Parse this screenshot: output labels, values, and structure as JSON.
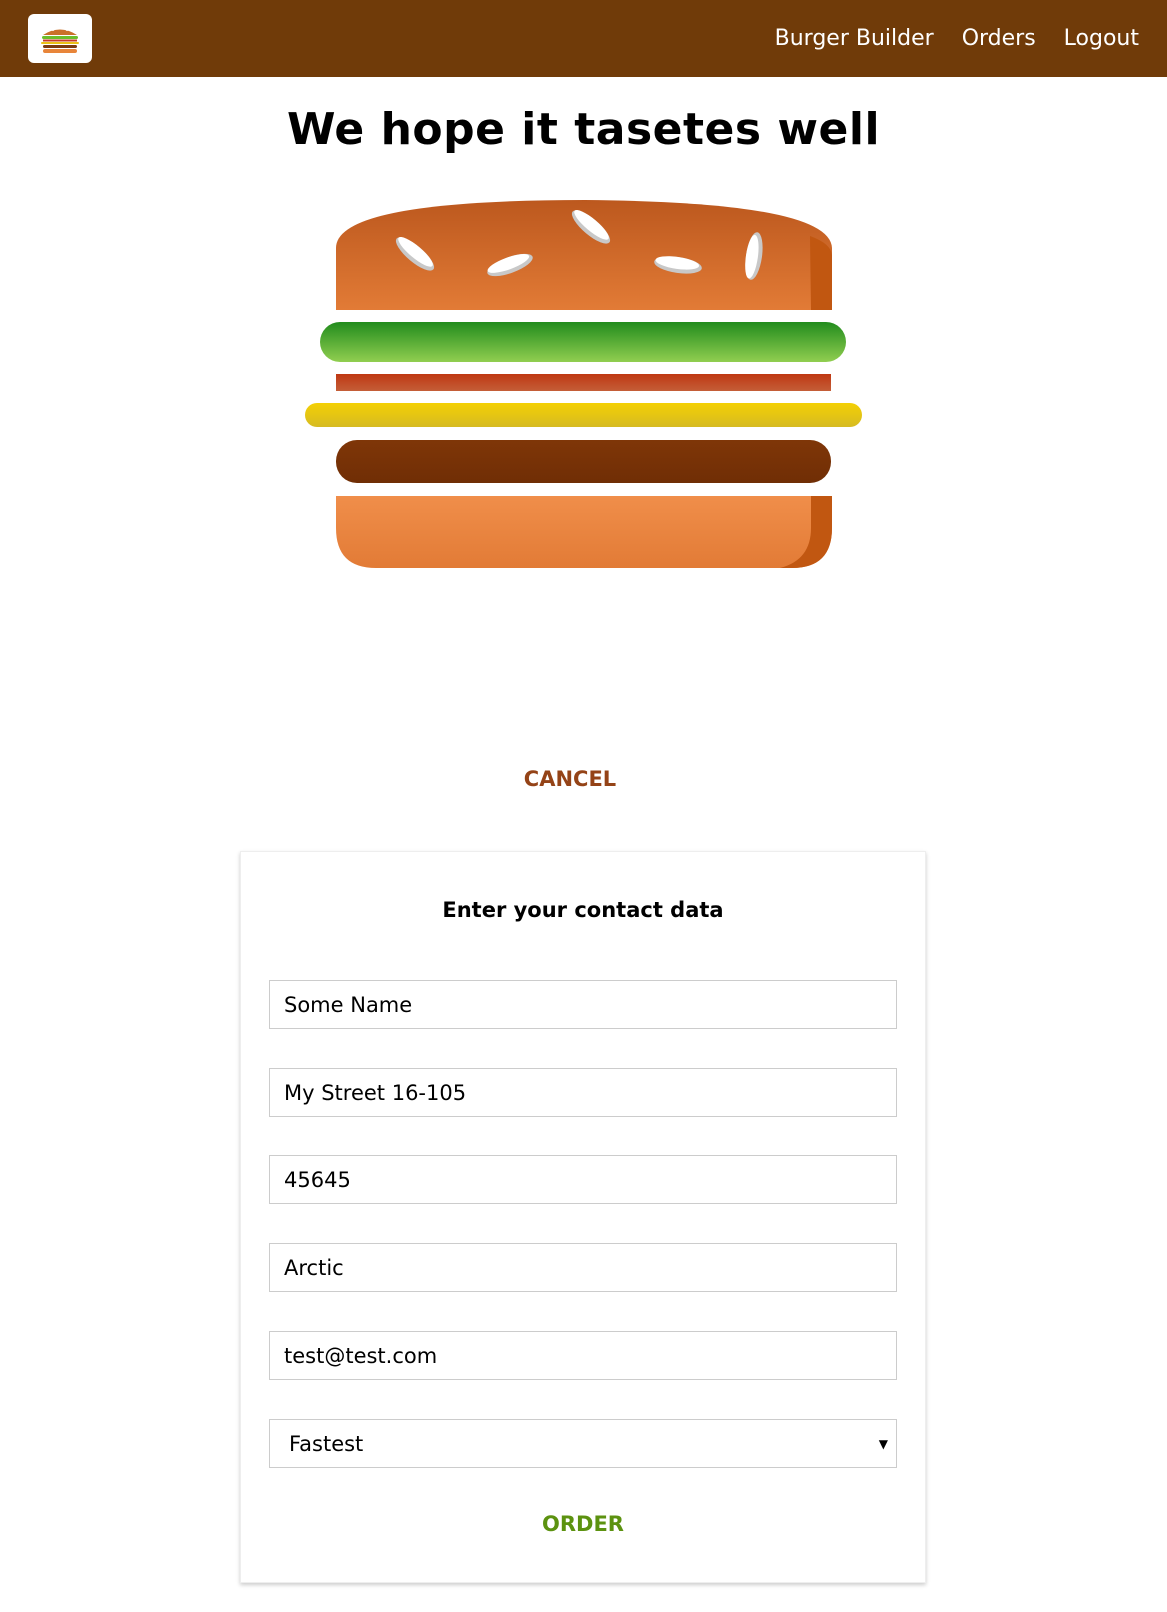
{
  "toolbar": {
    "logo_icon": "burger-logo-icon",
    "nav": [
      {
        "label": "Burger Builder"
      },
      {
        "label": "Orders"
      },
      {
        "label": "Logout"
      }
    ]
  },
  "checkout": {
    "title": "We hope it tasetes well",
    "cancel_label": "CANCEL"
  },
  "contact_form": {
    "title": "Enter your contact data",
    "fields": {
      "name": "Some Name",
      "street": "My Street 16-105",
      "zip": "45645",
      "country": "Arctic",
      "email": "test@test.com",
      "delivery": "Fastest"
    },
    "order_label": "ORDER"
  },
  "colors": {
    "toolbar_bg": "#703B09",
    "cancel": "#944317",
    "order": "#5C9210"
  }
}
